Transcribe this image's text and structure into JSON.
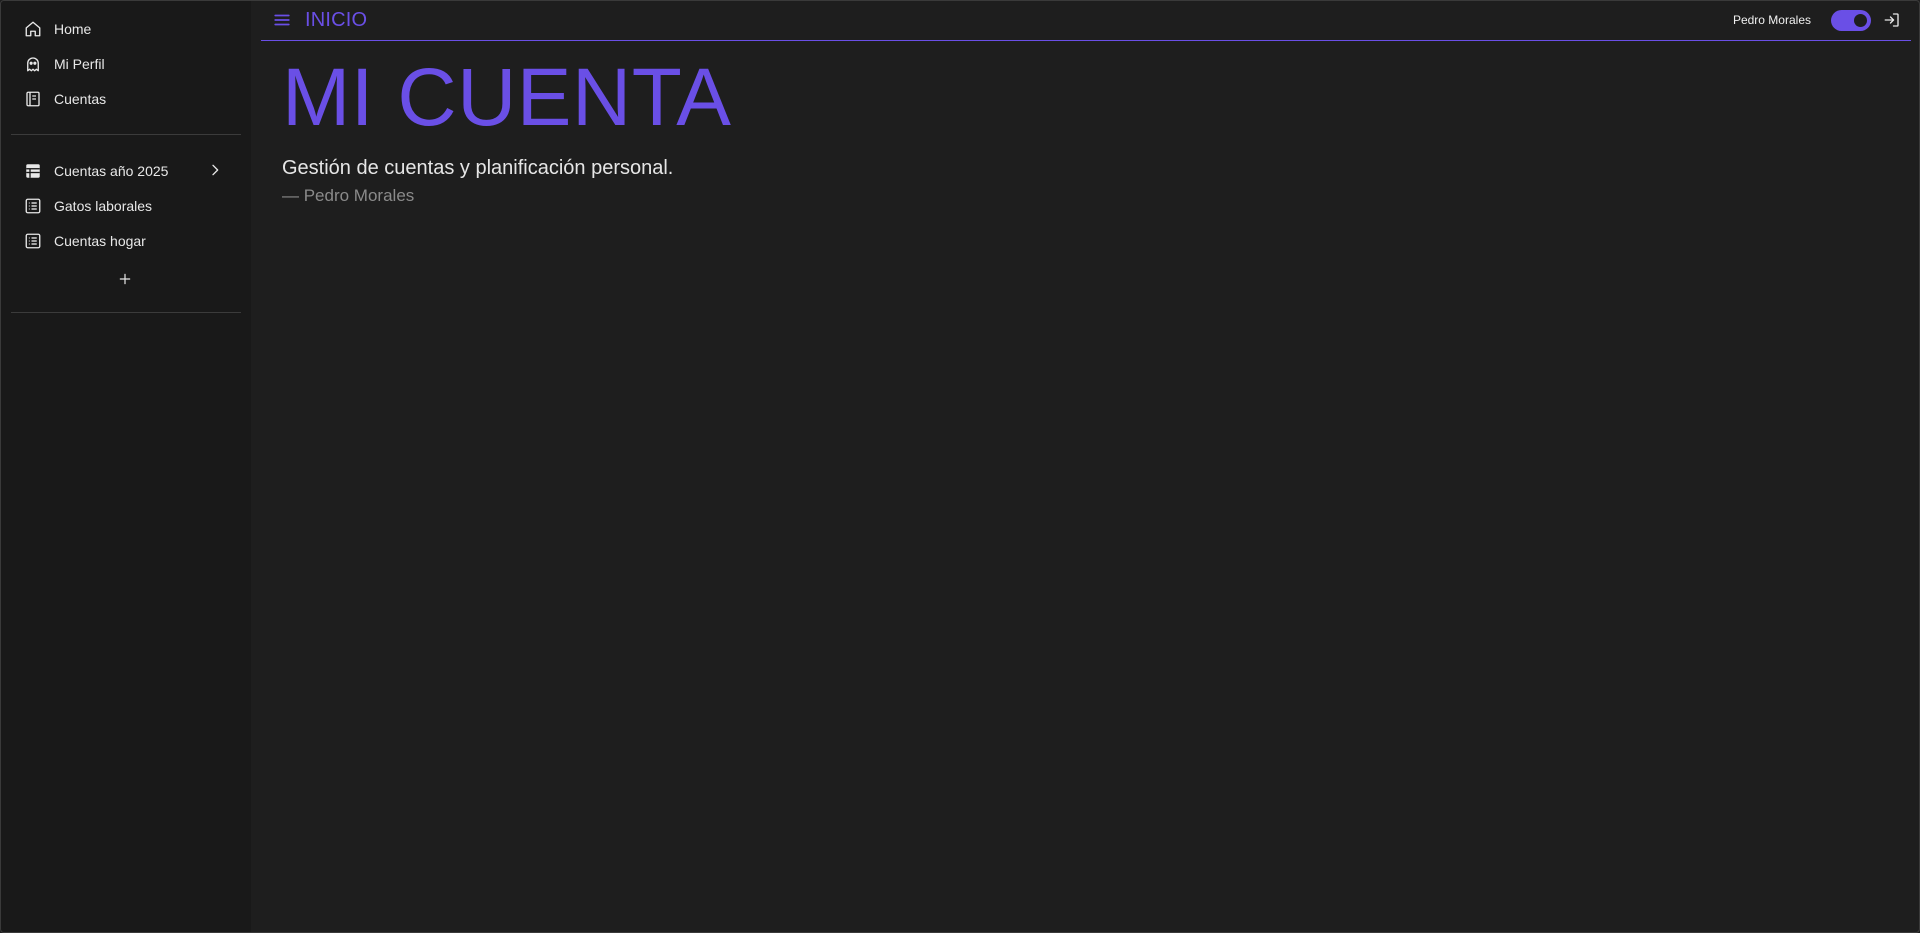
{
  "sidebar": {
    "primary_items": [
      {
        "label": "Home",
        "icon": "home-icon"
      },
      {
        "label": "Mi Perfil",
        "icon": "ghost-icon"
      },
      {
        "label": "Cuentas",
        "icon": "notebook-icon"
      }
    ],
    "sheet_items": [
      {
        "label": "Cuentas año 2025",
        "icon": "table-icon",
        "has_submenu": true
      },
      {
        "label": "Gatos laborales",
        "icon": "list-icon"
      },
      {
        "label": "Cuentas hogar",
        "icon": "list-icon"
      }
    ],
    "add_icon": "plus-icon"
  },
  "topbar": {
    "menu_icon": "hamburger-menu-icon",
    "title": "INICIO",
    "user_name": "Pedro Morales",
    "toggle_on": true,
    "logout_icon": "logout-icon"
  },
  "main": {
    "title": "MI CUENTA",
    "quote": "Gestión de cuentas y planificación personal.",
    "author": "— Pedro Morales"
  },
  "colors": {
    "accent": "#6a4fe6",
    "background": "#1e1e1e",
    "sidebar_background": "#191919",
    "text": "#e8e8e8",
    "muted_text": "#8a8a8a"
  }
}
